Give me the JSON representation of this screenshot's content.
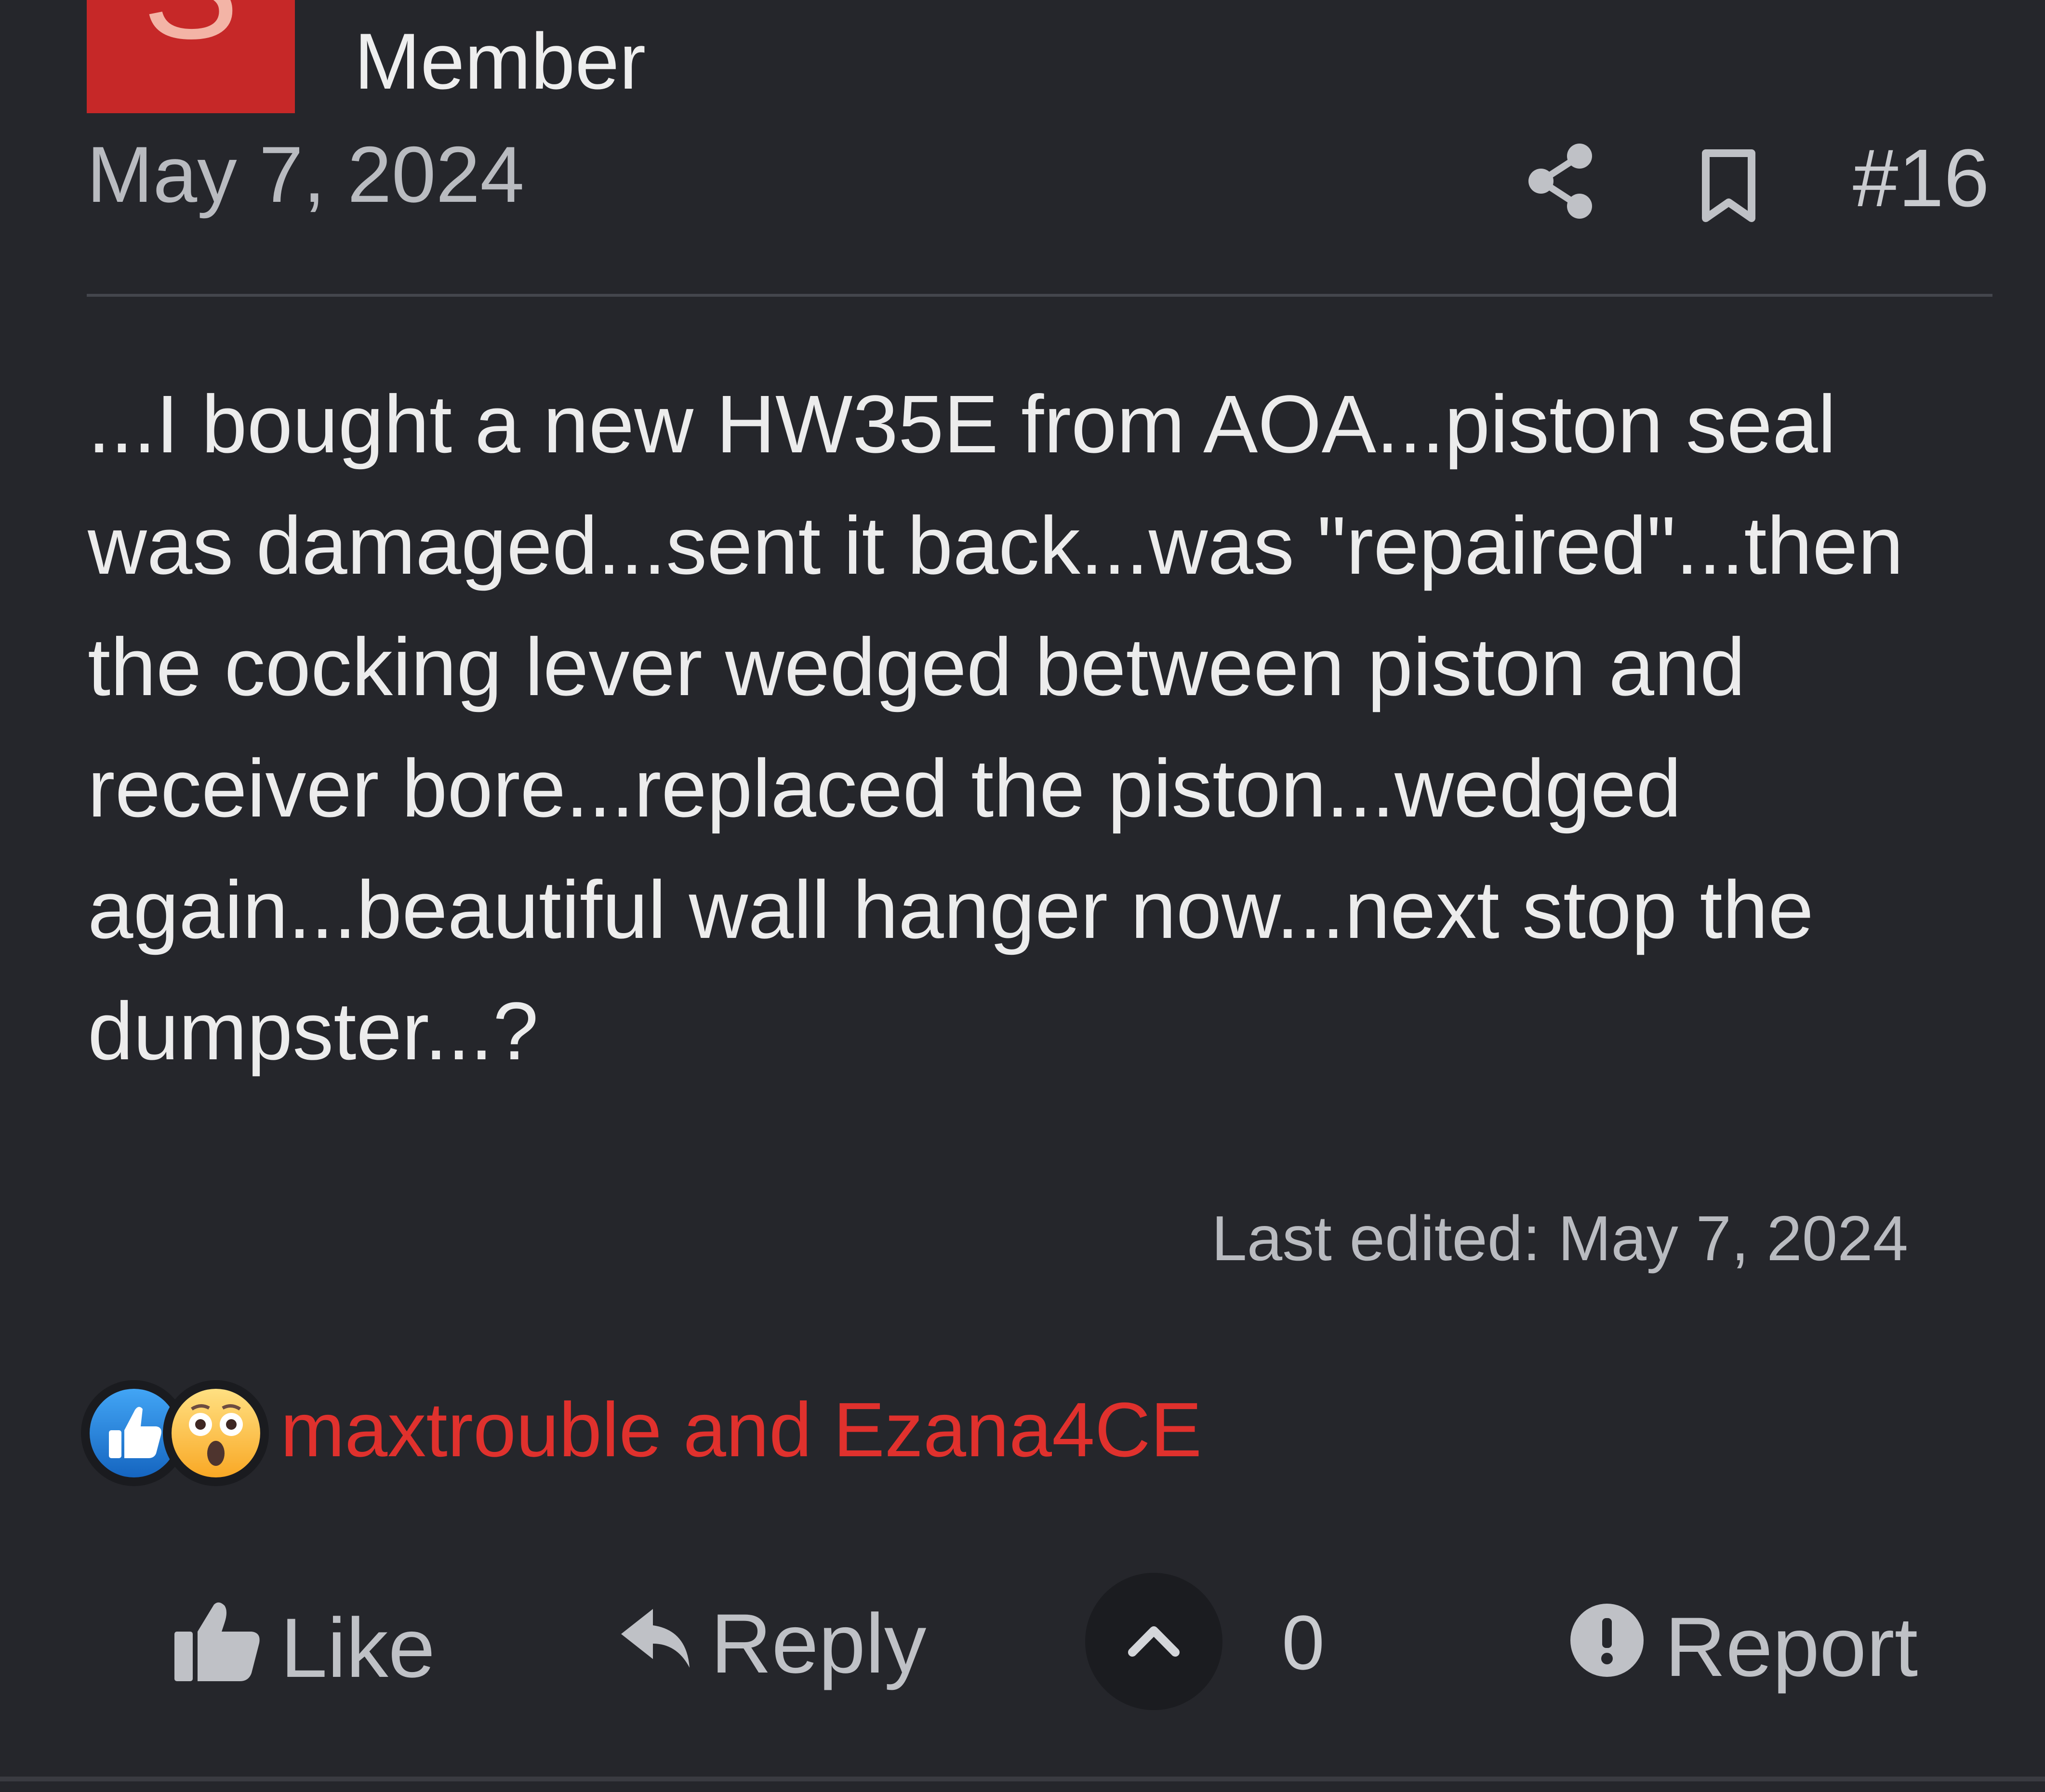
{
  "post": {
    "avatar_letter": "S",
    "avatar_color": "#c62828",
    "user_title": "Member",
    "date": "May 7, 2024",
    "post_number": "#16",
    "body": "...I bought a new HW35E from AOA...piston seal was damaged...sent it back...was \"repaired\"...then the cocking lever wedged between piston and receiver bore...replaced the piston...wedged again...beautiful wall hanger now...next stop the dumpster...?",
    "last_edited": "Last edited: May 7, 2024"
  },
  "header_actions": {
    "share_icon": "share-icon",
    "bookmark_icon": "bookmark-icon"
  },
  "reactions": {
    "icons": [
      "like-reaction-icon",
      "wow-reaction-icon"
    ],
    "users_text": "maxtrouble and Ezana4CE",
    "users_color": "#e0312d"
  },
  "actions": {
    "like_label": "Like",
    "reply_label": "Reply",
    "vote_count": "0",
    "report_label": "Report"
  },
  "colors": {
    "background": "#25262b",
    "text": "#ececec",
    "muted": "#b9bbc0",
    "accent_red": "#e0312d",
    "like_blue": "#1e88e5",
    "wow_yellow": "#fbc02d"
  }
}
